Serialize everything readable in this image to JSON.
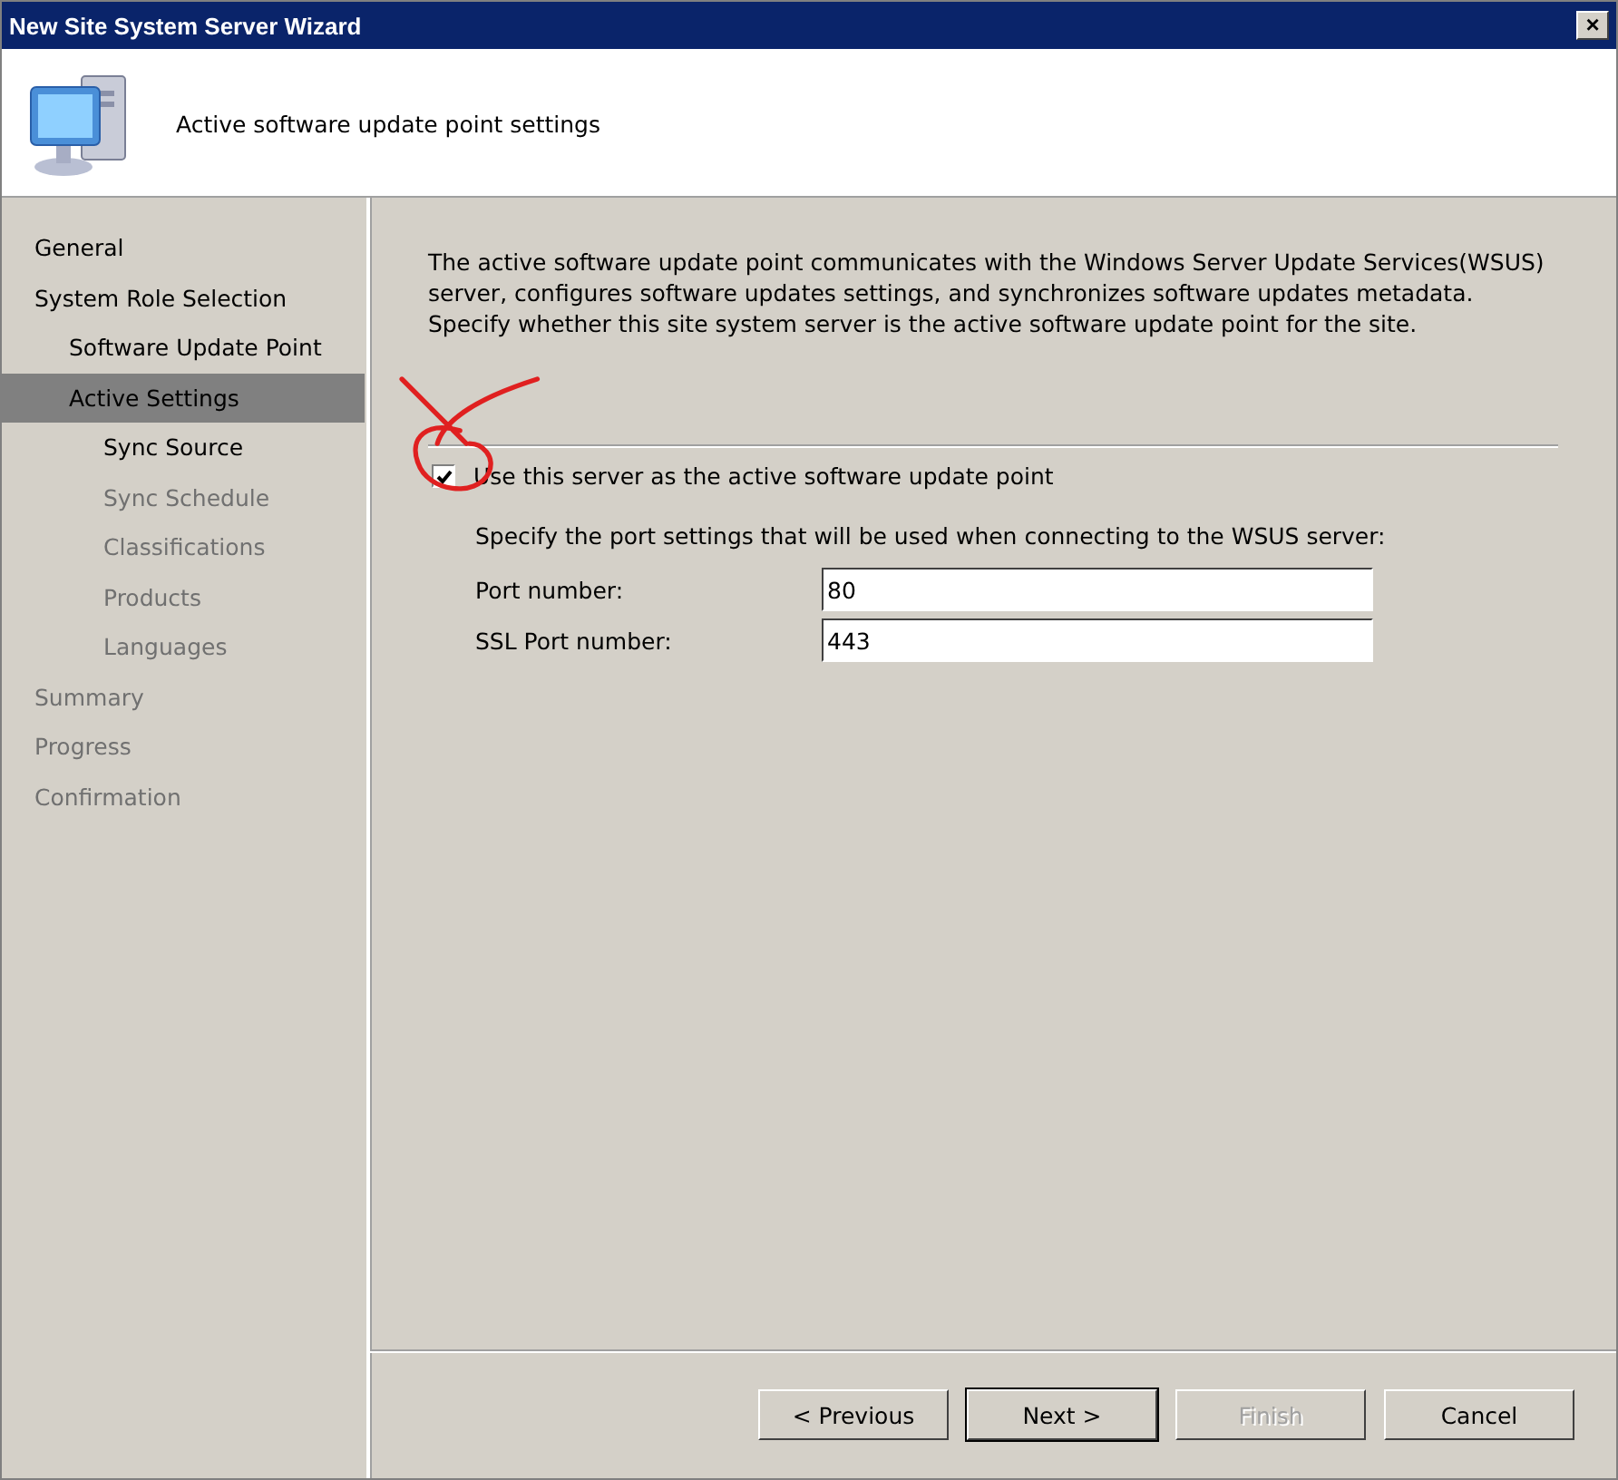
{
  "window": {
    "title": "New Site System Server Wizard",
    "close": "×"
  },
  "header": {
    "title": "Active software update point settings"
  },
  "sidebar": {
    "items": [
      {
        "label": "General",
        "selected": false,
        "disabled": false
      },
      {
        "label": "System Role Selection",
        "selected": false,
        "disabled": false,
        "children": [
          {
            "label": "Software Update Point",
            "selected": false,
            "disabled": false
          },
          {
            "label": "Active Settings",
            "selected": true,
            "disabled": false,
            "children": [
              {
                "label": "Sync Source",
                "selected": false,
                "disabled": false
              },
              {
                "label": "Sync Schedule",
                "selected": false,
                "disabled": true
              },
              {
                "label": "Classifications",
                "selected": false,
                "disabled": true
              },
              {
                "label": "Products",
                "selected": false,
                "disabled": true
              },
              {
                "label": "Languages",
                "selected": false,
                "disabled": true
              }
            ]
          }
        ]
      },
      {
        "label": "Summary",
        "selected": false,
        "disabled": true
      },
      {
        "label": "Progress",
        "selected": false,
        "disabled": true
      },
      {
        "label": "Confirmation",
        "selected": false,
        "disabled": true
      }
    ]
  },
  "content": {
    "description": "The active software update point communicates with the Windows Server Update Services(WSUS) server, configures software updates settings, and synchronizes software updates metadata. Specify whether this site system server is the active software update point for the site.",
    "checkbox": {
      "label": "Use this server as the active software update point",
      "checked": true
    },
    "port_hint": "Specify the port settings that will be used when connecting to the WSUS server:",
    "fields": [
      {
        "label": "Port number:",
        "value": "80"
      },
      {
        "label": "SSL Port number:",
        "value": "443"
      }
    ]
  },
  "buttons": [
    {
      "label": "< Previous",
      "disabled": false,
      "default": false
    },
    {
      "label": "Next >",
      "disabled": false,
      "default": true
    },
    {
      "label": "Finish",
      "disabled": true,
      "default": false
    },
    {
      "label": "Cancel",
      "disabled": false,
      "default": false
    }
  ]
}
